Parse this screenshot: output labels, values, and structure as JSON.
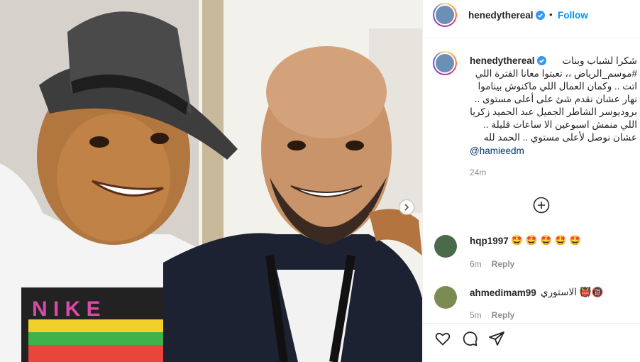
{
  "post": {
    "author": "henedythereal",
    "follow_label": "Follow",
    "separator": "•",
    "caption": "شكرا لشباب وبنات\n#موسم_الرياض ،، تعبتوا معانا الفترة اللي\nاتت .. وكمان العمال اللي ماكنوش بيناموا\nنهار عشان نقدم شئ على أعلى مستوى ..\nبروديوسر الشاطر الجميل عبد الحميد زكريا\nاللي منمش اسبوعين الا ساعات قليلة ..\nعشان نوصل لأعلى مستوي .. الحمد لله",
    "mention": "@hamieedm",
    "time": "24m"
  },
  "comments": [
    {
      "user": "hqp1997",
      "text": "🤩 🤩 🤩 🤩 🤩",
      "time": "6m",
      "reply_label": "Reply"
    },
    {
      "user": "ahmedimam99",
      "text": "الاستوري 👹🔞",
      "time": "5m",
      "reply_label": "Reply"
    }
  ],
  "colors": {
    "accent": "#0095f6",
    "verified": "#3897f0",
    "muted": "#8e8e8e"
  },
  "icons": [
    "verified-badge-icon",
    "chevron-right-icon",
    "add-circle-icon",
    "heart-icon",
    "comment-icon",
    "share-icon"
  ]
}
